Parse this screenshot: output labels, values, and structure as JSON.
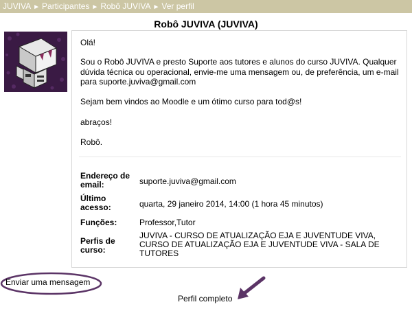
{
  "breadcrumb": [
    "JUVIVA",
    "Participantes",
    "Robô JUVIVA",
    "Ver perfil"
  ],
  "breadcrumb_separator": "►",
  "page_title": "Robô JUVIVA (JUVIVA)",
  "description": {
    "greeting": "Olá!",
    "body": "Sou o Robô JUVIVA e presto Suporte aos tutores e alunos do curso JUVIVA. Qualquer dúvida técnica ou operacional, envie-me uma mensagem ou, de preferência, um e-mail para suporte.juviva@gmail.com",
    "welcome": "Sejam bem vindos ao Moodle e um ótimo curso para tod@s!",
    "hugs": "abraços!",
    "signature": "Robô."
  },
  "info": {
    "email_label": "Endereço de email:",
    "email_value": "suporte.juviva@gmail.com",
    "last_access_label": "Último acesso:",
    "last_access_value": "quarta, 29 janeiro 2014, 14:00  (1 hora 45 minutos)",
    "roles_label": "Funções:",
    "roles_value": "Professor,Tutor",
    "course_profiles_label": "Perfis de curso:",
    "course_profiles_value": "JUVIVA - CURSO DE ATUALIZAÇÃO EJA E JUVENTUDE VIVA, CURSO DE ATUALIZAÇÃO EJA E JUVENTUDE VIVA - SALA DE TUTORES"
  },
  "actions": {
    "send_message": "Enviar uma mensagem",
    "full_profile": "Perfil completo"
  },
  "colors": {
    "breadcrumb_bg": "#ccc6a4",
    "annotation": "#5b3466",
    "avatar_bg": "#3a1a44"
  }
}
